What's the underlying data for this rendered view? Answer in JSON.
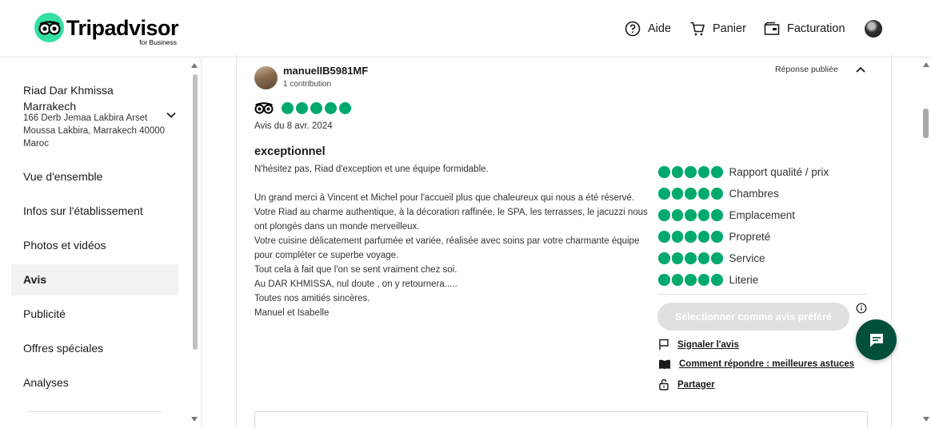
{
  "header": {
    "logo_word": "Tripadvisor",
    "logo_sub": "for Business",
    "nav": [
      {
        "label": "Aide",
        "icon": "help-circle-icon"
      },
      {
        "label": "Panier",
        "icon": "cart-icon"
      },
      {
        "label": "Facturation",
        "icon": "billing-folder-icon"
      }
    ],
    "profile_icon": "avatar-icon"
  },
  "sidebar": {
    "business_name": "Riad Dar Khmissa Marrakech",
    "address": "166 Derb Jemaa Lakbira Arset Moussa Lakbira, Marrakech 40000 Maroc",
    "items": [
      {
        "label": "Vue d'ensemble",
        "active": false
      },
      {
        "label": "Infos sur l'établissement",
        "active": false
      },
      {
        "label": "Photos et vidéos",
        "active": false
      },
      {
        "label": "Avis",
        "active": true
      },
      {
        "label": "Publicité",
        "active": false
      },
      {
        "label": "Offres spéciales",
        "active": false
      },
      {
        "label": "Analyses",
        "active": false
      }
    ]
  },
  "review": {
    "username": "manuelIB5981MF",
    "contributions": "1 contribution",
    "status": "Réponse publiée",
    "rating": 5,
    "date": "Avis du 8 avr. 2024",
    "title": "exceptionnel",
    "body": "N'hésitez pas, Riad d'exception et une équipe formidable.\n\nUn grand merci à Vincent et Michel pour l'accueil plus que chaleureux qui nous a été réservé. Votre Riad au charme authentique, à la décoration raffinée, le SPA, les terrasses, le jacuzzi nous ont plongés dans un monde merveilleux.\nVotre cuisine délicatement parfumée et variée, réalisée avec soins par votre charmante équipe pour compléter ce superbe voyage.\nTout cela à fait que l'on se sent vraiment chez soi.\nAu DAR KHMISSA, nul doute , on y retournera.....\nToutes nos amitiés sincères.\nManuel et Isabelle",
    "sub_ratings": [
      {
        "label": "Rapport qualité / prix",
        "value": 5
      },
      {
        "label": "Chambres",
        "value": 5
      },
      {
        "label": "Emplacement",
        "value": 5
      },
      {
        "label": "Propreté",
        "value": 5
      },
      {
        "label": "Service",
        "value": 5
      },
      {
        "label": "Literie",
        "value": 5
      }
    ],
    "preferred_button": "Sélectionner comme avis préféré",
    "actions": {
      "report": "Signaler l'avis",
      "tips": "Comment répondre : meilleures astuces",
      "share": "Partager"
    }
  },
  "colors": {
    "bubble_green": "#00aa6c",
    "logo_green": "#34e0a1",
    "chat_fab": "#004f3b",
    "active_bg": "#f2f2f2"
  }
}
